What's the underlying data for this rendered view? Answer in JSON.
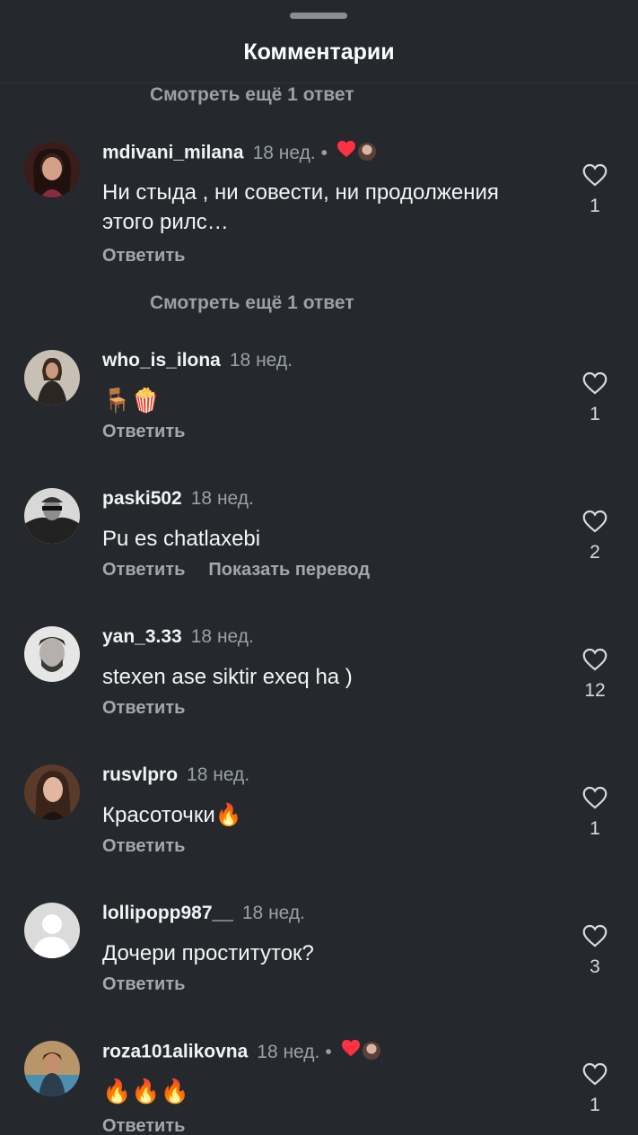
{
  "header": {
    "title": "Комментарии"
  },
  "view_replies_top": "Смотреть ещё 1 ответ",
  "view_replies_mid": "Смотреть ещё 1 ответ",
  "reply_label": "Ответить",
  "translate_label": "Показать перевод",
  "comments": [
    {
      "username": "mdivani_milana",
      "age": "18 нед.",
      "text": "Ни стыда , ни совести, ни продолжения этого рилс…",
      "likes": "1",
      "author_liked": true
    },
    {
      "username": "who_is_ilona",
      "age": "18 нед.",
      "text": "🪑🍿",
      "likes": "1",
      "author_liked": false
    },
    {
      "username": "paski502",
      "age": "18 нед.",
      "text": "Pu es chatlaxebi",
      "likes": "2",
      "author_liked": false
    },
    {
      "username": "yan_3.33",
      "age": "18 нед.",
      "text": "stexen ase siktir exeq ha )",
      "likes": "12",
      "author_liked": false
    },
    {
      "username": "rusvlpro",
      "age": "18 нед.",
      "text": "Красоточки🔥",
      "likes": "1",
      "author_liked": false
    },
    {
      "username": "lollipopp987__",
      "age": "18 нед.",
      "text": "Дочери проституток?",
      "likes": "3",
      "author_liked": false
    },
    {
      "username": "roza101alikovna",
      "age": "18 нед.",
      "text": "🔥🔥🔥",
      "likes": "1",
      "author_liked": true
    }
  ],
  "icons": [
    "heart-outline-icon",
    "heart-filled-icon",
    "default-avatar-icon"
  ],
  "colors": {
    "background": "#25292e",
    "secondary_text": "#9aa0a7",
    "like_red": "#ff3040"
  }
}
